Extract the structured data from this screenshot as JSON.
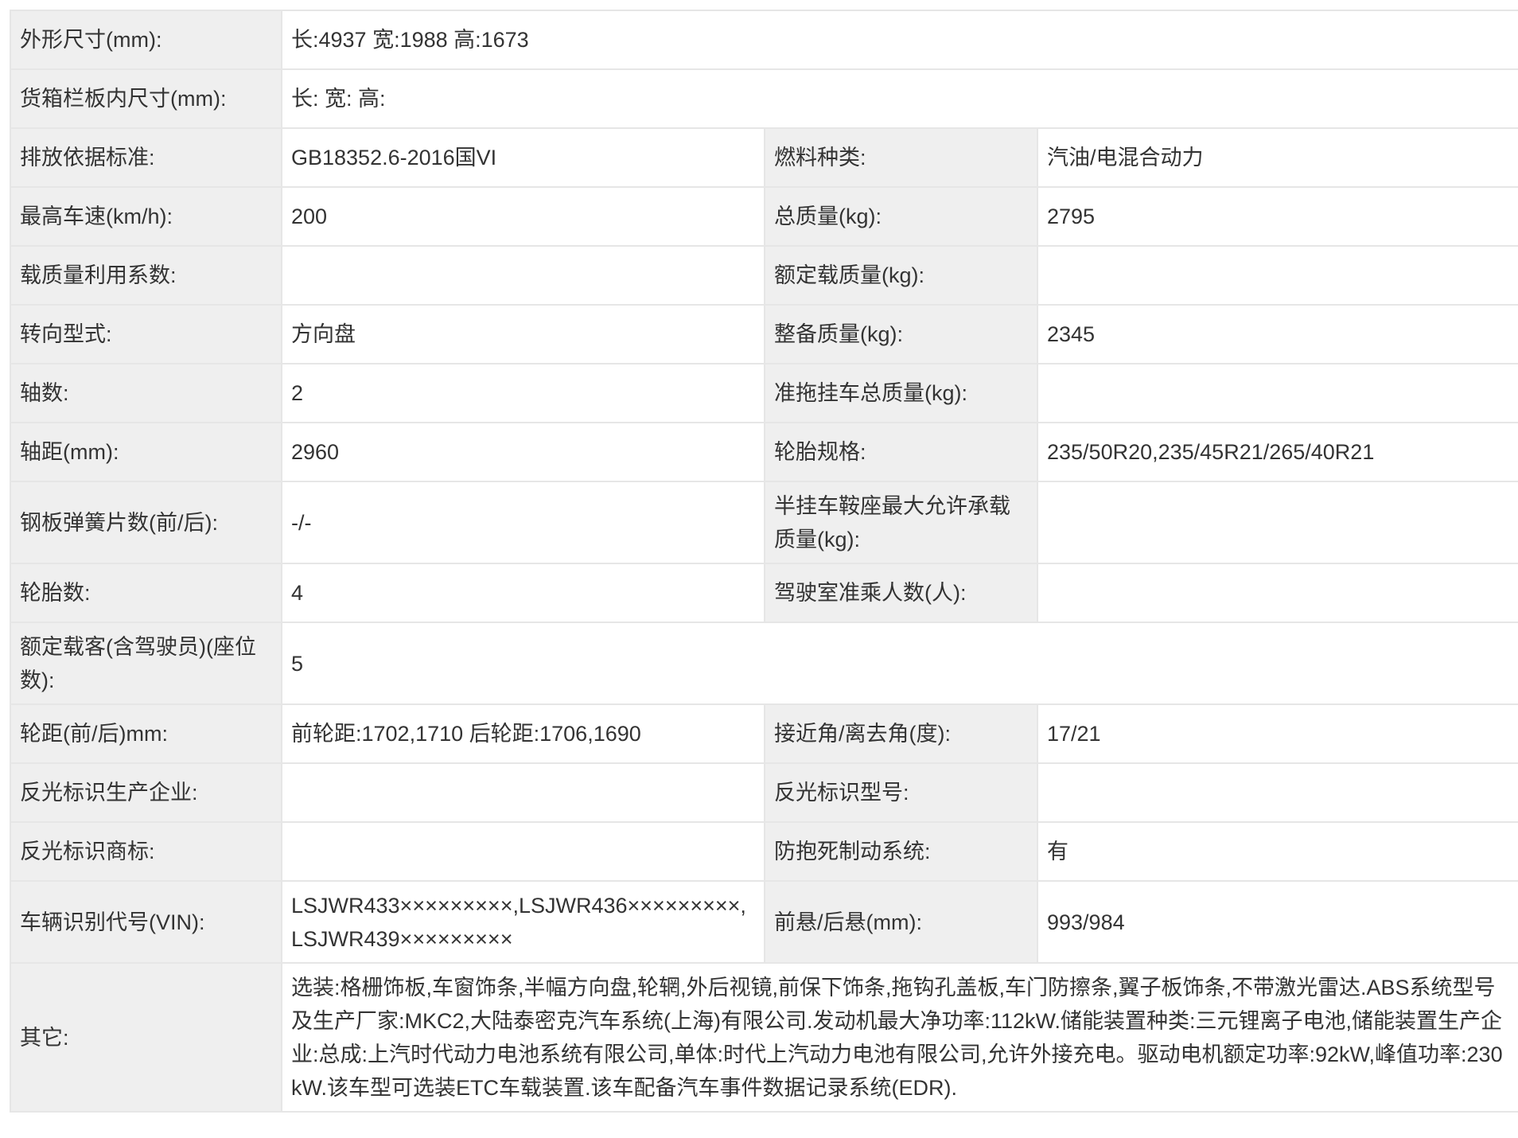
{
  "rows": [
    {
      "label": "外形尺寸(mm):",
      "value": "长:4937 宽:1988 高:1673"
    },
    {
      "label": "货箱栏板内尺寸(mm):",
      "value": "长: 宽: 高:"
    },
    {
      "label": "排放依据标准:",
      "value": "GB18352.6-2016国VI",
      "label2": "燃料种类:",
      "value2": "汽油/电混合动力"
    },
    {
      "label": "最高车速(km/h):",
      "value": "200",
      "label2": "总质量(kg):",
      "value2": "2795"
    },
    {
      "label": "载质量利用系数:",
      "value": "",
      "label2": "额定载质量(kg):",
      "value2": ""
    },
    {
      "label": "转向型式:",
      "value": "方向盘",
      "label2": "整备质量(kg):",
      "value2": "2345"
    },
    {
      "label": "轴数:",
      "value": "2",
      "label2": "准拖挂车总质量(kg):",
      "value2": ""
    },
    {
      "label": "轴距(mm):",
      "value": "2960",
      "label2": "轮胎规格:",
      "value2": "235/50R20,235/45R21/265/40R21"
    },
    {
      "label": "钢板弹簧片数(前/后):",
      "value": "-/-",
      "label2": "半挂车鞍座最大允许承载质量(kg):",
      "value2": ""
    },
    {
      "label": "轮胎数:",
      "value": "4",
      "label2": "驾驶室准乘人数(人):",
      "value2": ""
    },
    {
      "label": "额定载客(含驾驶员)(座位数):",
      "value": "5"
    },
    {
      "label": "轮距(前/后)mm:",
      "value": "前轮距:1702,1710 后轮距:1706,1690",
      "label2": "接近角/离去角(度):",
      "value2": "17/21"
    },
    {
      "label": "反光标识生产企业:",
      "value": "",
      "label2": "反光标识型号:",
      "value2": ""
    },
    {
      "label": "反光标识商标:",
      "value": "",
      "label2": "防抱死制动系统:",
      "value2": "有"
    },
    {
      "label": "车辆识别代号(VIN):",
      "value": "LSJWR433×××××××××,LSJWR436×××××××××,LSJWR439×××××××××",
      "label2": "前悬/后悬(mm):",
      "value2": "993/984"
    },
    {
      "label": "其它:",
      "value": "选装:格栅饰板,车窗饰条,半幅方向盘,轮辋,外后视镜,前保下饰条,拖钩孔盖板,车门防擦条,翼子板饰条,不带激光雷达.ABS系统型号及生产厂家:MKC2,大陆泰密克汽车系统(上海)有限公司.发动机最大净功率:112kW.储能装置种类:三元锂离子电池,储能装置生产企业:总成:上汽时代动力电池系统有限公司,单体:时代上汽动力电池有限公司,允许外接充电。驱动电机额定功率:92kW,峰值功率:230kW.该车型可选装ETC车载装置.该车配备汽车事件数据记录系统(EDR)."
    }
  ]
}
